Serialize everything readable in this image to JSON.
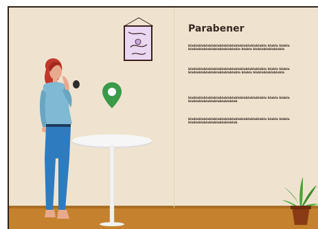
{
  "content": {
    "title": "Parabener",
    "paragraphs": [
      "blablablablablablablablablablablablablablabla blabla blablablablablablablablablablablabla blabla blablablablablabla",
      "blablablablablablablablablablablablablablabla blabla blablablablablablablablablablablabla blabla blablablablablabla",
      "blablablablablablablablablablablablablablabla blabla blablablablablablablablablablablab",
      "blablablablablablablablablablablablablablabla blabla blablablablablablablablablablablab"
    ]
  },
  "colors": {
    "wall": "#efe3cf",
    "floor": "#c4822f",
    "pin": "#3a9a4a",
    "shirt": "#7fb9d4",
    "pants": "#2f7bbf",
    "hair": "#c0392b",
    "table": "#f4f4f4",
    "plant_pot": "#8a3a14",
    "plant_leaves": "#3f8f2f"
  },
  "icons": {
    "location": "map-pin-icon",
    "picture": "framed-picture-icon"
  }
}
